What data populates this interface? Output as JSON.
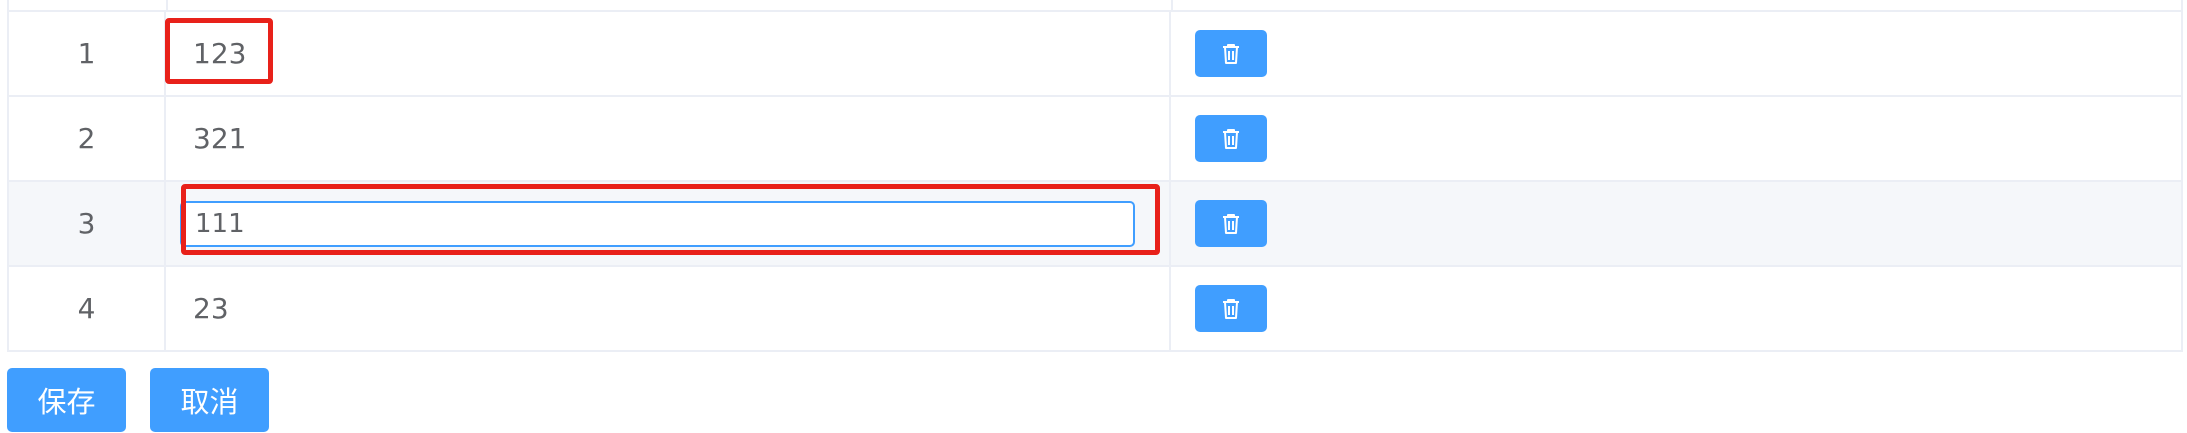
{
  "table": {
    "rows": [
      {
        "index": "1",
        "value": "123",
        "editing": false
      },
      {
        "index": "2",
        "value": "321",
        "editing": false
      },
      {
        "index": "3",
        "value": "111",
        "editing": true
      },
      {
        "index": "4",
        "value": "23",
        "editing": false
      }
    ],
    "delete_icon": "trash-icon"
  },
  "footer": {
    "save_label": "保存",
    "cancel_label": "取消"
  },
  "colors": {
    "primary": "#409eff",
    "annotation": "#e8211a",
    "highlight_row": "#f5f7fa",
    "border": "#ebeef5",
    "text": "#606266"
  }
}
